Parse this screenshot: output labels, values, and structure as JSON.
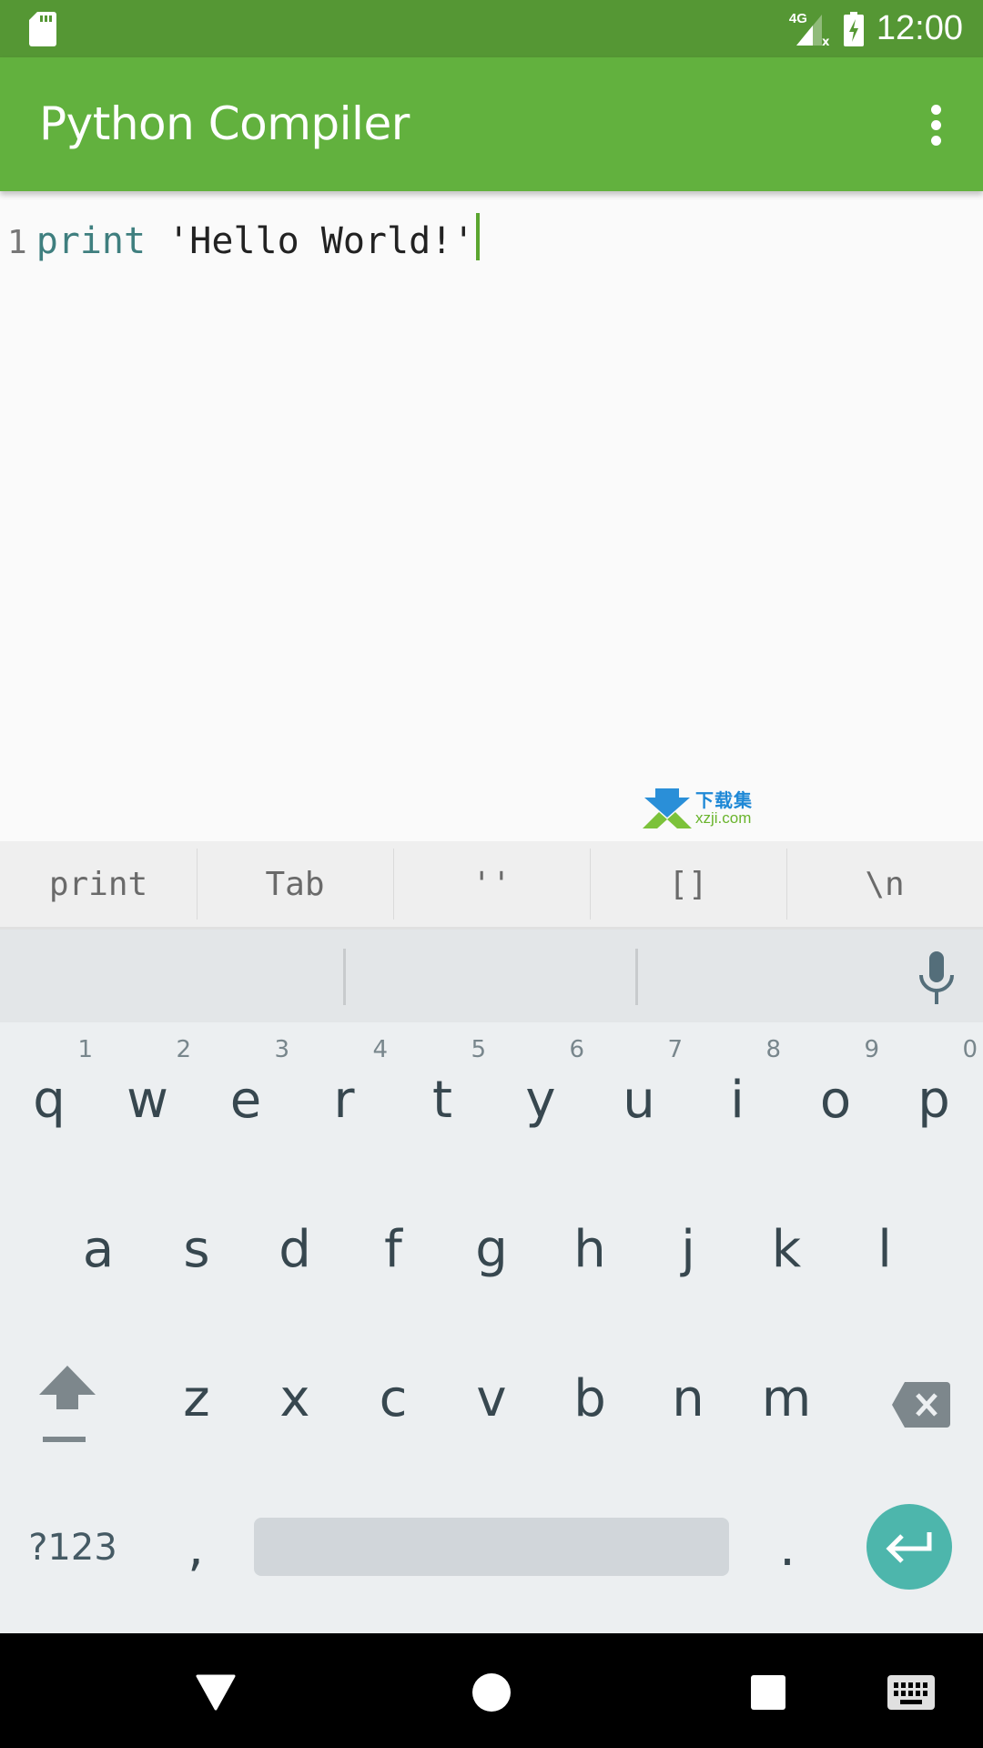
{
  "status_bar": {
    "left_icon": "sd-card-icon",
    "network_label": "4G",
    "icons": [
      "signal-no-data-icon",
      "battery-charging-icon"
    ],
    "time": "12:00",
    "background": "#559734"
  },
  "app_bar": {
    "title": "Python Compiler",
    "menu_icon": "more-vert-icon",
    "background": "#62b13e"
  },
  "editor": {
    "lines": [
      {
        "number": "1",
        "keyword": "print",
        "rest": " 'Hello World!'"
      }
    ],
    "keyword_color": "#3f7f7f",
    "cursor_color": "#5aa52f"
  },
  "watermark": {
    "cn": "下载集",
    "en": "xzji.com"
  },
  "shortcuts": [
    "print",
    "Tab",
    "''",
    "[]",
    "\\n"
  ],
  "keyboard": {
    "suggestions": [
      "",
      "",
      ""
    ],
    "mic_icon": "microphone-icon",
    "row1": [
      {
        "key": "q",
        "hint": "1"
      },
      {
        "key": "w",
        "hint": "2"
      },
      {
        "key": "e",
        "hint": "3"
      },
      {
        "key": "r",
        "hint": "4"
      },
      {
        "key": "t",
        "hint": "5"
      },
      {
        "key": "y",
        "hint": "6"
      },
      {
        "key": "u",
        "hint": "7"
      },
      {
        "key": "i",
        "hint": "8"
      },
      {
        "key": "o",
        "hint": "9"
      },
      {
        "key": "p",
        "hint": "0"
      }
    ],
    "row2": [
      "a",
      "s",
      "d",
      "f",
      "g",
      "h",
      "j",
      "k",
      "l"
    ],
    "row3": [
      "z",
      "x",
      "c",
      "v",
      "b",
      "n",
      "m"
    ],
    "symbols_label": "?123",
    "comma": ",",
    "period": ".",
    "enter_color": "#4db6ac"
  },
  "nav_bar": {
    "buttons": [
      "back-icon",
      "home-icon",
      "recents-icon",
      "keyboard-switch-icon"
    ]
  }
}
